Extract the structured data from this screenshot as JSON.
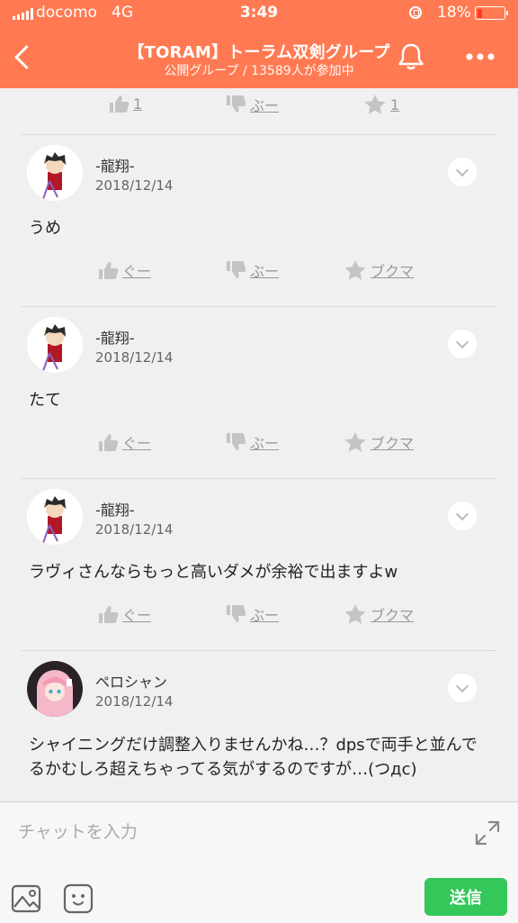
{
  "status_bar": {
    "carrier": "docomo",
    "network": "4G",
    "time": "3:49",
    "battery": "18%"
  },
  "header": {
    "title": "【TORAM】トーラム双剣グループ",
    "subtitle": "公開グループ / 13589人が参加中",
    "icons": {
      "back": "chevron-left-icon",
      "bell": "bell-icon",
      "more": "more-icon"
    }
  },
  "top_reactions": {
    "like": "1",
    "dislike": "ぶー",
    "bookmark": "1"
  },
  "messages": [
    {
      "user": "-龍翔-",
      "date": "2018/12/14",
      "text": "うめ",
      "reactions": {
        "like": "ぐー",
        "dislike": "ぶー",
        "bookmark": "ブクマ"
      }
    },
    {
      "user": "-龍翔-",
      "date": "2018/12/14",
      "text": "たて",
      "reactions": {
        "like": "ぐー",
        "dislike": "ぶー",
        "bookmark": "ブクマ"
      }
    },
    {
      "user": "-龍翔-",
      "date": "2018/12/14",
      "text": "ラヴィさんならもっと高いダメが余裕で出ますよw",
      "reactions": {
        "like": "ぐー",
        "dislike": "ぶー",
        "bookmark": "ブクマ"
      }
    },
    {
      "user": "ペロシャン",
      "date": "2018/12/14",
      "text": "シャイニングだけ調整入りませんかね…？dpsで両手と並んでるかむしろ超えちゃってる気がするのですが…(つдc)"
    }
  ],
  "input": {
    "placeholder": "チャットを入力",
    "send_label": "送信"
  },
  "colors": {
    "accent": "#ff7a52",
    "send": "#34c759",
    "background": "#f0f0f0"
  }
}
